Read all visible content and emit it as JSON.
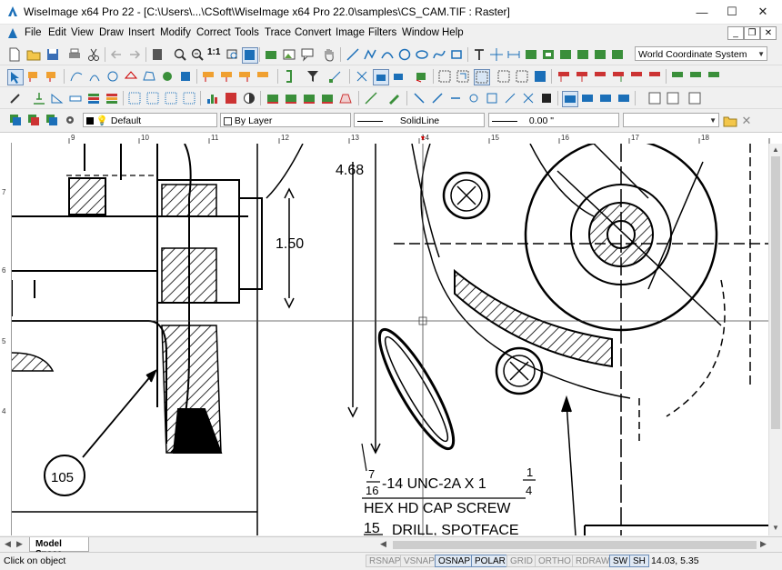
{
  "window": {
    "title": "WiseImage x64 Pro 22 - [C:\\Users\\...\\CSoft\\WiseImage x64 Pro 22.0\\samples\\CS_CAM.TIF : Raster]",
    "minimize_label": "—",
    "maximize_label": "☐",
    "close_label": "✕"
  },
  "menu": [
    {
      "label": "File"
    },
    {
      "label": "Edit"
    },
    {
      "label": "View"
    },
    {
      "label": "Draw"
    },
    {
      "label": "Insert"
    },
    {
      "label": "Modify"
    },
    {
      "label": "Correct"
    },
    {
      "label": "Tools"
    },
    {
      "label": "Trace"
    },
    {
      "label": "Convert"
    },
    {
      "label": "Image"
    },
    {
      "label": "Filters"
    },
    {
      "label": "Window"
    },
    {
      "label": "Help"
    }
  ],
  "mdi_buttons": {
    "minimize": "_",
    "restore": "❐",
    "close": "✕"
  },
  "coord_system": {
    "value": "World Coordinate System"
  },
  "properties": {
    "layer": "Default",
    "color": "By Layer",
    "linetype": "SolidLine",
    "lineweight": "0.00 \""
  },
  "ruler": {
    "top_ticks": [
      "9",
      "10",
      "11",
      "12",
      "13",
      "14",
      "15",
      "16",
      "17",
      "18"
    ],
    "left_ticks": [
      "7",
      "6",
      "5",
      "4"
    ]
  },
  "drawing": {
    "dim_1": "4.68",
    "dim_2": "1.50",
    "balloon": "105",
    "note_line1_num": "7",
    "note_line1_den": "16",
    "note_line1_rest": "-14 UNC-2A X 1",
    "note_line1_frac_num": "1",
    "note_line1_frac_den": "4",
    "note_line2": "HEX HD CAP SCREW",
    "note_line3_num": "15",
    "note_line3_rest": "DRILL, SPOTFACE"
  },
  "tabs": {
    "model_space": "Model Space"
  },
  "status": {
    "message": "Click on object",
    "toggles": [
      {
        "label": "RSNAP",
        "on": false
      },
      {
        "label": "VSNAP",
        "on": false
      },
      {
        "label": "OSNAP",
        "on": true
      },
      {
        "label": "POLAR",
        "on": true
      },
      {
        "label": "GRID",
        "on": false
      },
      {
        "label": "ORTHO",
        "on": false
      },
      {
        "label": "RDRAW",
        "on": false
      },
      {
        "label": "SW",
        "on": true
      },
      {
        "label": "SH",
        "on": true
      }
    ],
    "coordinates": "14.03, 5.35"
  }
}
